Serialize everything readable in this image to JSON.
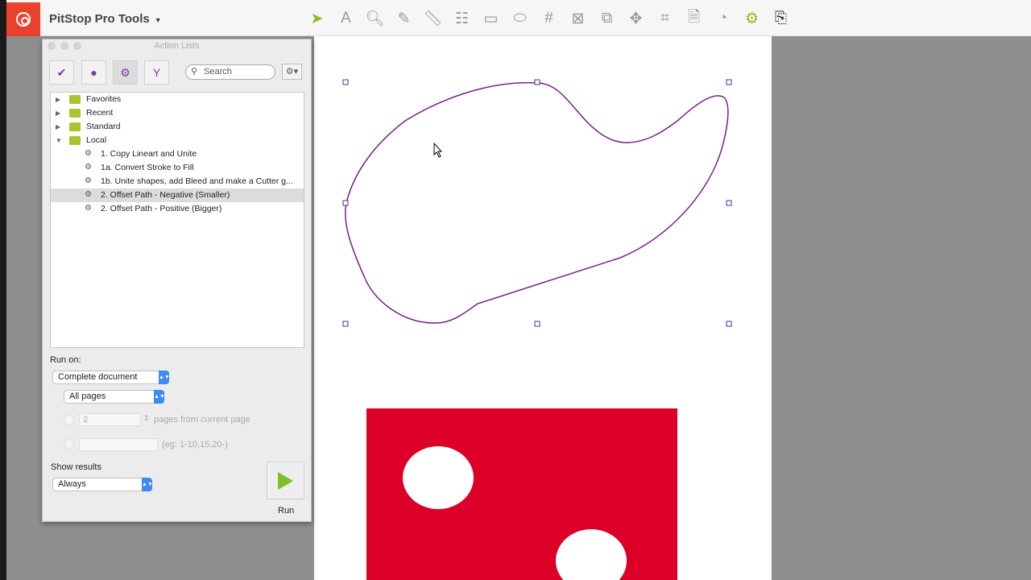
{
  "app": {
    "title": "PitStop Pro Tools"
  },
  "toolbar": {
    "tools": [
      "select",
      "text",
      "inspect",
      "edit",
      "measure",
      "split",
      "rectangle",
      "ellipse",
      "grid",
      "placeholder",
      "arrange",
      "move",
      "crop",
      "preflight",
      "certified",
      "action-lists",
      "export"
    ]
  },
  "panel": {
    "title": "Action Lists",
    "search_placeholder": "Search",
    "tree": [
      {
        "label": "Favorites",
        "type": "folder",
        "expanded": false
      },
      {
        "label": "Recent",
        "type": "folder",
        "expanded": false
      },
      {
        "label": "Standard",
        "type": "folder",
        "expanded": false
      },
      {
        "label": "Local",
        "type": "folder",
        "expanded": true
      },
      {
        "label": "1. Copy Lineart and Unite",
        "type": "action"
      },
      {
        "label": "1a. Convert Stroke to Fill",
        "type": "action"
      },
      {
        "label": "1b. Unite shapes, add Bleed and make a Cutter g...",
        "type": "action"
      },
      {
        "label": "2. Offset Path - Negative (Smaller)",
        "type": "action",
        "selected": true
      },
      {
        "label": "2. Offset Path - Positive (Bigger)",
        "type": "action"
      }
    ],
    "run_on_label": "Run on:",
    "run_on_value": "Complete document",
    "pages_value": "All pages",
    "pages_count": "2",
    "pages_from_label": "pages from current page",
    "range_hint": "(eg: 1-10,15,20-)",
    "show_results_label": "Show results",
    "show_results_value": "Always",
    "run_label": "Run"
  },
  "colors": {
    "accent": "#e8412c",
    "green": "#8dbb1f",
    "shape_fill": "#dc0028",
    "path": "#7a1f8a"
  }
}
